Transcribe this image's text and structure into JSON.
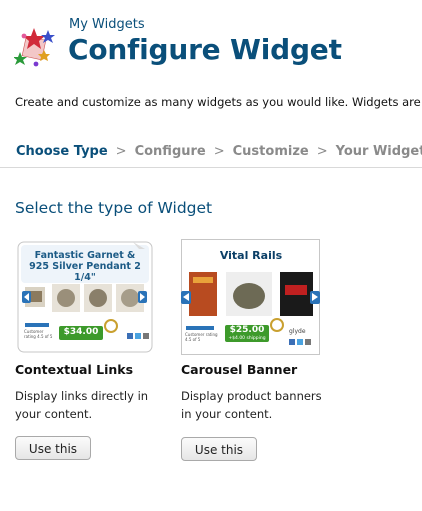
{
  "header": {
    "breadcrumb": "My Widgets",
    "title": "Configure Widget"
  },
  "intro": "Create and customize as many widgets as you would like. Widgets are",
  "steps": {
    "items": [
      "Choose Type",
      "Configure",
      "Customize",
      "Your Widget"
    ],
    "separator": ">",
    "active": "Choose Type"
  },
  "section_title": "Select the type of Widget",
  "cards": [
    {
      "title": "Contextual Links",
      "description": "Display links directly in your content.",
      "button": "Use this",
      "preview": {
        "headline": "Fantastic Garnet & 925 Silver Pendant 2 1/4\"",
        "price": "$34.00",
        "rating_text": "Customer rating 4.5 of 5"
      }
    },
    {
      "title": "Carousel Banner",
      "description": "Display product banners in your content.",
      "button": "Use this",
      "preview": {
        "headline": "Vital Rails",
        "price": "$25.00",
        "shipping": "+$4.00 shipping",
        "rating_text": "Customer rating 4.5 of 5",
        "brand": "glyde"
      }
    }
  ],
  "colors": {
    "accent": "#0a4f7a",
    "step_inactive": "#8a8a8a",
    "price_green": "#3d9a2b"
  }
}
